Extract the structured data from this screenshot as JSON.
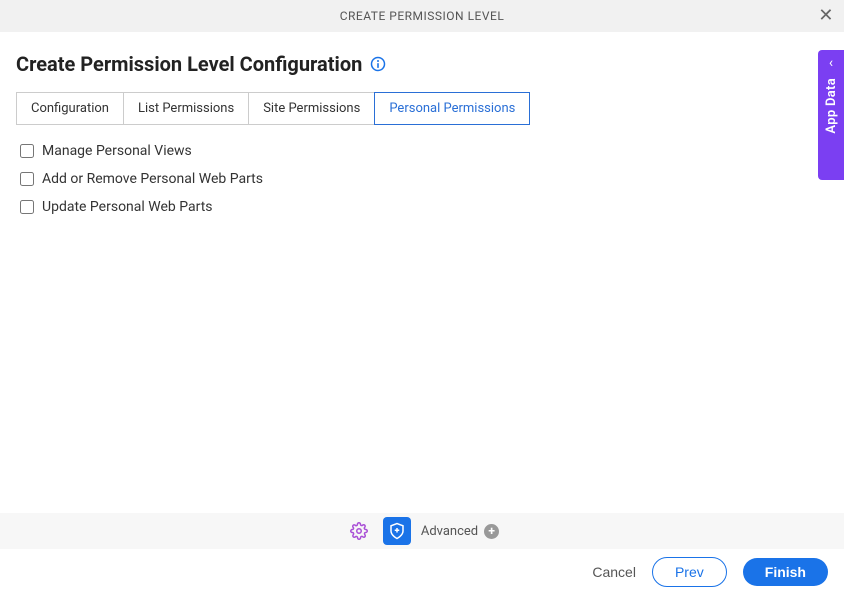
{
  "titlebar": {
    "title": "CREATE PERMISSION LEVEL"
  },
  "heading": "Create Permission Level Configuration",
  "tabs": [
    {
      "label": "Configuration",
      "active": false
    },
    {
      "label": "List Permissions",
      "active": false
    },
    {
      "label": "Site Permissions",
      "active": false
    },
    {
      "label": "Personal Permissions",
      "active": true
    }
  ],
  "checkboxes": [
    {
      "label": "Manage Personal Views",
      "checked": false
    },
    {
      "label": "Add or Remove Personal Web Parts",
      "checked": false
    },
    {
      "label": "Update Personal Web Parts",
      "checked": false
    }
  ],
  "sideTab": {
    "label": "App Data"
  },
  "toolbar": {
    "advancedLabel": "Advanced"
  },
  "footer": {
    "cancel": "Cancel",
    "prev": "Prev",
    "finish": "Finish"
  }
}
